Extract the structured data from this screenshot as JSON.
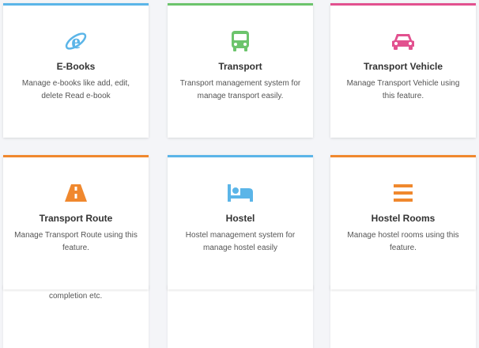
{
  "colors": {
    "blue": "#5bb5e8",
    "green": "#6cc46c",
    "pink": "#e2518f",
    "orange": "#f0882e"
  },
  "cards": [
    {
      "title": "E-Books",
      "desc": "Manage e-books like add, edit, delete Read e-book",
      "icon": "internet-explorer-icon",
      "color": "blue"
    },
    {
      "title": "Transport",
      "desc": "Transport management system for manage transport easily.",
      "icon": "bus-icon",
      "color": "green"
    },
    {
      "title": "Transport Vehicle",
      "desc": "Manage Transport Vehicle using this feature.",
      "icon": "car-icon",
      "color": "pink"
    },
    {
      "title": "Transport Route",
      "desc": "Manage Transport Route using this feature.",
      "icon": "road-icon",
      "color": "orange"
    },
    {
      "title": "Hostel",
      "desc": "Hostel management system for manage hostel easily",
      "icon": "bed-icon",
      "color": "blue"
    },
    {
      "title": "Hostel Rooms",
      "desc": "Manage hostel rooms using this feature.",
      "icon": "list-icon",
      "color": "orange"
    }
  ],
  "partial_text": "completion etc."
}
